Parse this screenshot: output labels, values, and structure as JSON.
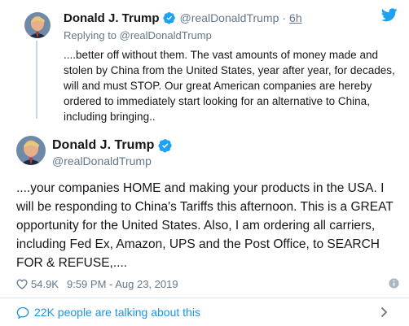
{
  "colors": {
    "link": "#1b95e0",
    "twitter_blue": "#1da1f2",
    "muted": "#657786",
    "text": "#14171a",
    "thread_line": "#ccd6dd",
    "divider": "#e1e8ed"
  },
  "parent_tweet": {
    "name": "Donald J. Trump",
    "handle": "@realDonaldTrump",
    "dot": "·",
    "time": "6h",
    "replying_prefix": "Replying to",
    "replying_to": "@realDonaldTrump",
    "text": "....better off without them. The vast amounts of money made and stolen by China from the United States, year after year, for decades, will and must STOP. Our great American companies are hereby ordered to immediately start looking for an alternative to China, including bringing..",
    "icons": [
      "avatar",
      "verified-badge-icon",
      "twitter-bird-icon"
    ]
  },
  "main_tweet": {
    "name": "Donald J. Trump",
    "handle": "@realDonaldTrump",
    "text": "....your companies HOME and making your products in the USA. I will be responding to China's Tariffs this afternoon. This is a GREAT opportunity for the United States. Also, I am ordering all carriers, including Fed Ex, Amazon, UPS and the Post Office, to SEARCH FOR & REFUSE,....",
    "likes": "54.9K",
    "timestamp": "9:59 PM - Aug 23, 2019",
    "icons": [
      "avatar",
      "verified-badge-icon",
      "heart-icon",
      "info-icon"
    ]
  },
  "footer": {
    "talking_label": "22K people are talking about this",
    "icons": [
      "speech-bubble-icon",
      "chevron-right-icon"
    ]
  }
}
